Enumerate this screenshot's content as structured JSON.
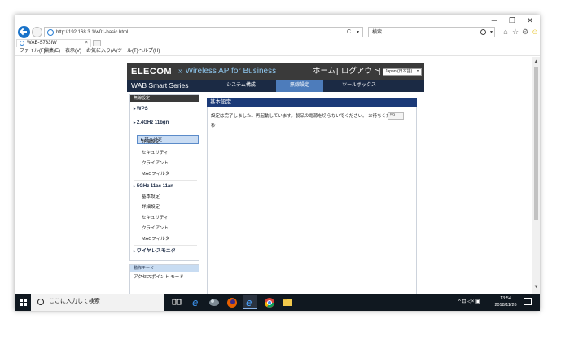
{
  "browser": {
    "url": "http://192.168.3.1/w01-basic.html",
    "search_placeholder": "検索...",
    "tab_title": "WAB-S733IW",
    "tab_close": "×",
    "reload": "C",
    "dropdown": "▾",
    "window_controls": {
      "minimize": "─",
      "restore": "❐",
      "close": "✕"
    },
    "menu": [
      "ファイル(F)",
      "編集(E)",
      "表示(V)",
      "お気に入り(A)",
      "ツール(T)",
      "ヘルプ(H)"
    ]
  },
  "page": {
    "logo": "ELECOM",
    "product_arrow": "»",
    "product": "Wireless AP for Business",
    "home": "ホーム",
    "separator": "|",
    "logout": "ログアウト",
    "language": "Japan (日本語)",
    "series": "WAB Smart Series",
    "nav": {
      "system": "システム構成",
      "wireless": "無線設定",
      "tools": "ツールボックス"
    },
    "left_menu": {
      "header": "無線設定",
      "wps": "WPS",
      "band24": "2.4GHz 11bgn",
      "band24_items": [
        "基本設定",
        "詳細設定",
        "セキュリティ",
        "クライアント",
        "MACフィルタ"
      ],
      "band5": "5GHz 11ac 11an",
      "band5_items": [
        "基本設定",
        "詳細設定",
        "セキュリティ",
        "クライアント",
        "MACフィルタ"
      ],
      "monitor": "ワイヤレスモニタ"
    },
    "mode": {
      "header": "動作モード",
      "value": "アクセスポイント モード"
    },
    "content": {
      "title": "基本設定",
      "message": "設定は完了しました。再起動しています。製品の電源を切らないでください。 お待ちください。",
      "countdown": "59",
      "unit": "秒"
    }
  },
  "taskbar": {
    "search_text": "ここに入力して検索",
    "tray": "^ ⊡ ◁× ▣",
    "time": "13:54",
    "date": "2018/11/26"
  },
  "colors": {
    "header_bg": "#3a3a3a",
    "nav_bg": "#1b2a44",
    "nav_active": "#4d7cbb",
    "content_head": "#1b3a78",
    "accent_text": "#8ec6ee",
    "taskbar_bg": "#101820"
  }
}
